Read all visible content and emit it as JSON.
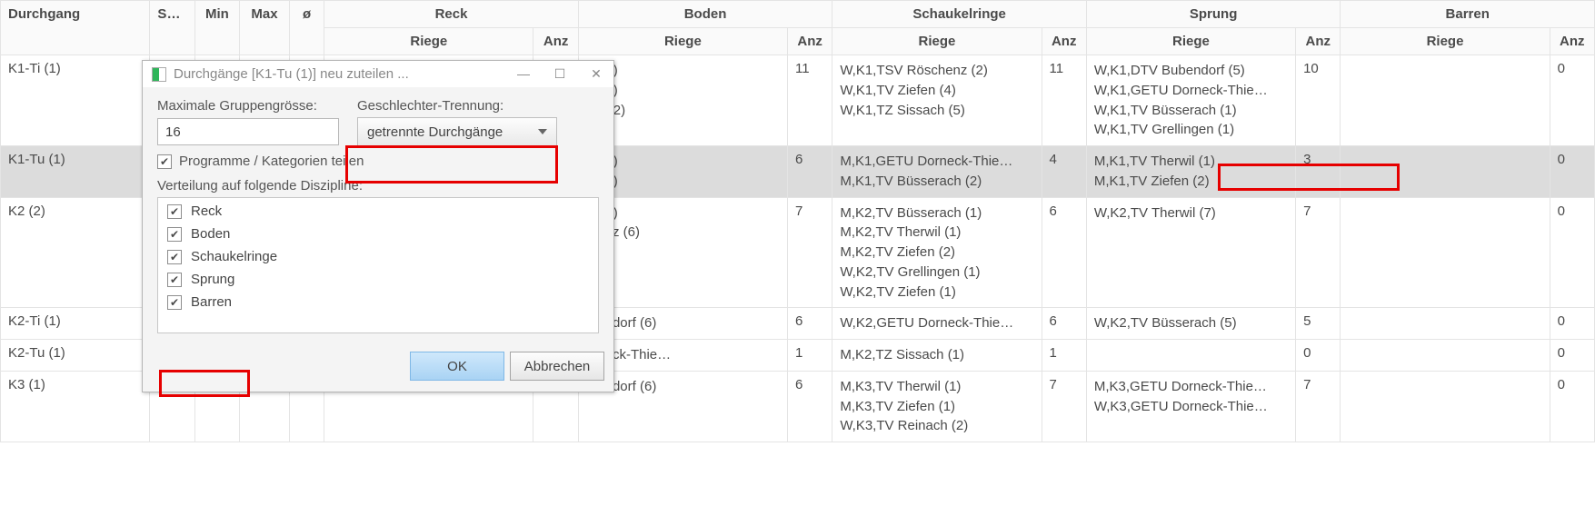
{
  "headers": {
    "durchgang": "Durchgang",
    "sum": "Sum",
    "min": "Min",
    "max": "Max",
    "avg": "ø",
    "disciplines": [
      "Reck",
      "Boden",
      "Schaukelringe",
      "Sprung",
      "Barren"
    ],
    "riege": "Riege",
    "anz": "Anz"
  },
  "rows": [
    {
      "dg": "K1-Ti (1)",
      "boden": {
        "riege": [
          "... (4)",
          "... (5)",
          "...g (2)"
        ],
        "anz": "11"
      },
      "ringe": {
        "riege": [
          "W,K1,TSV Röschenz (2)",
          "W,K1,TV Ziefen (4)",
          "W,K1,TZ Sissach (5)"
        ],
        "anz": "11"
      },
      "sprung": {
        "riege": [
          "W,K1,DTV Bubendorf (5)",
          "W,K1,GETU Dorneck-Thie…",
          "W,K1,TV Büsserach (1)",
          "W,K1,TV Grellingen (1)"
        ],
        "anz": "10"
      },
      "barren": {
        "riege": [],
        "anz": "0"
      }
    },
    {
      "dg": "K1-Tu (1)",
      "boden": {
        "riege": [
          "... (4)",
          "... (2)"
        ],
        "anz": "6"
      },
      "ringe": {
        "riege": [
          "M,K1,GETU Dorneck-Thie…",
          "M,K1,TV Büsserach (2)"
        ],
        "anz": "4"
      },
      "sprung": {
        "riege": [
          "M,K1,TV Therwil (1)",
          "M,K1,TV Ziefen (2)"
        ],
        "anz": "3"
      },
      "barren": {
        "riege": [],
        "anz": "0"
      }
    },
    {
      "dg": "K2 (2)",
      "boden": {
        "riege": [
          "... (1)",
          "...enz (6)"
        ],
        "anz": "7"
      },
      "ringe": {
        "riege": [
          "M,K2,TV Büsserach (1)",
          "M,K2,TV Therwil (1)",
          "M,K2,TV Ziefen (2)",
          "W,K2,TV Grellingen (1)",
          "W,K2,TV Ziefen (1)"
        ],
        "anz": "6"
      },
      "sprung": {
        "riege": [
          "W,K2,TV Therwil (7)"
        ],
        "anz": "7"
      },
      "barren": {
        "riege": [],
        "anz": "0"
      }
    },
    {
      "dg": "K2-Ti (1)",
      "boden": {
        "riege": [
          "...endorf (6)"
        ],
        "anz": "6"
      },
      "ringe": {
        "riege": [
          "W,K2,GETU Dorneck-Thie…"
        ],
        "anz": "6"
      },
      "sprung": {
        "riege": [
          "W,K2,TV Büsserach (5)"
        ],
        "anz": "5"
      },
      "barren": {
        "riege": [],
        "anz": "0"
      }
    },
    {
      "dg": "K2-Tu (1)",
      "boden": {
        "riege": [
          "...neck-Thie…"
        ],
        "anz": "1"
      },
      "ringe": {
        "riege": [
          "M,K2,TZ Sissach (1)"
        ],
        "anz": "1"
      },
      "sprung": {
        "riege": [],
        "anz": "0"
      },
      "barren": {
        "riege": [],
        "anz": "0"
      }
    },
    {
      "dg": "K3 (1)",
      "boden": {
        "riege": [
          "...endorf (6)"
        ],
        "anz": "6"
      },
      "ringe": {
        "riege": [
          "M,K3,TV Therwil (1)",
          "M,K3,TV Ziefen (1)",
          "W,K3,TV Reinach (2)"
        ],
        "anz": "7"
      },
      "sprung": {
        "riege": [
          "M,K3,GETU Dorneck-Thie…",
          "W,K3,GETU Dorneck-Thie…"
        ],
        "anz": "7"
      },
      "barren": {
        "riege": [],
        "anz": "0"
      }
    }
  ],
  "dialog": {
    "title": "Durchgänge [K1-Tu (1)] neu zuteilen ...",
    "max_group_label": "Maximale Gruppengrösse:",
    "max_group_value": "16",
    "gender_label": "Geschlechter-Trennung:",
    "gender_value": "getrennte Durchgänge",
    "split_programs": "Programme / Kategorien teilen",
    "split_programs_checked": true,
    "dist_label": "Verteilung auf folgende Diszipline:",
    "disciplines": [
      {
        "label": "Reck",
        "checked": true
      },
      {
        "label": "Boden",
        "checked": true
      },
      {
        "label": "Schaukelringe",
        "checked": true
      },
      {
        "label": "Sprung",
        "checked": true
      },
      {
        "label": "Barren",
        "checked": true
      }
    ],
    "ok": "OK",
    "cancel": "Abbrechen"
  }
}
